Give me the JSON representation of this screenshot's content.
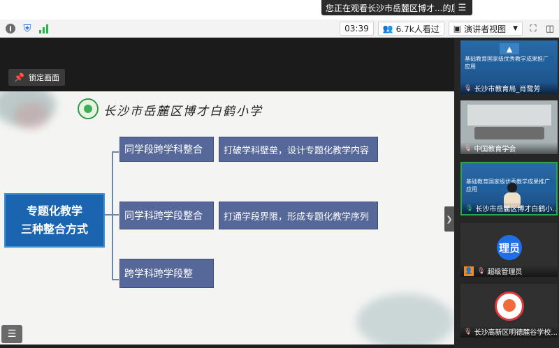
{
  "share_banner": {
    "text": "您正在观看长沙市岳麓区博才...的屏幕",
    "menu_icon": "menu-icon"
  },
  "toolbar": {
    "timer": "03:39",
    "viewers": "6.7k人看过",
    "view_mode": "演讲者视图",
    "icons": [
      "info-icon",
      "shield-icon",
      "signal-icon",
      "people-icon",
      "layout-icon",
      "fullscreen-icon",
      "sidebar-icon"
    ]
  },
  "lock_tip": {
    "label": "锁定画面"
  },
  "slide": {
    "school": "长沙市岳麓区博才白鹤小学",
    "main_title_line1": "专题化教学",
    "main_title_line2": "三种整合方式",
    "items": [
      {
        "left": "同学段跨学科整合",
        "right": "打破学科壁垒，设计专题化教学内容"
      },
      {
        "left": "同学科跨学段整合",
        "right": "打通学段界限，形成专题化教学序列"
      },
      {
        "left": "跨学科跨学段整"
      }
    ]
  },
  "participants": [
    {
      "name": "长沙市教育局_肖鹜芳",
      "slide_title": "基础教育国家级优秀教学成果推广应用",
      "mic": "muted"
    },
    {
      "name": "中国教育学会",
      "mic": "muted"
    },
    {
      "name": "长沙市岳麓区博才白鹤小...",
      "slide_title": "基础教育国家级优秀教学成果推广应用",
      "mic": "on",
      "active": true
    },
    {
      "name": "超级管理员",
      "avatar_text": "理员",
      "mic": "muted",
      "host": true
    },
    {
      "name": "长沙高新区明德麓谷学校...",
      "mic": "muted"
    }
  ],
  "colors": {
    "slide_box_main": "#1a64b0",
    "slide_box": "#56679a",
    "active_border": "#2ea44f",
    "avatar_blue": "#1f6fe8"
  }
}
